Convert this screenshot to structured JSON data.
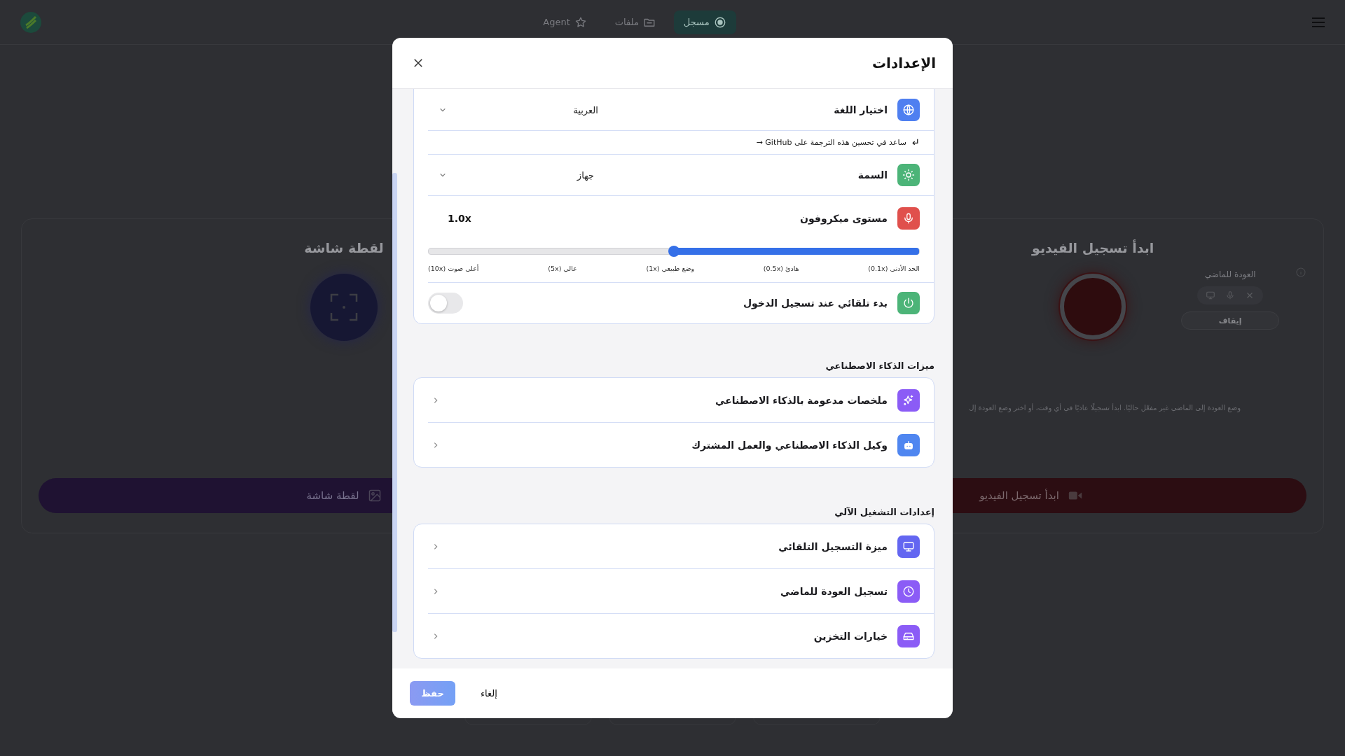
{
  "nav": {
    "tabs": [
      {
        "label": "مسجل",
        "selected": true
      },
      {
        "label": "ملفات",
        "selected": false
      },
      {
        "label": "Agent",
        "selected": false
      }
    ]
  },
  "screenshot_card": {
    "title": "لقطة شاشة",
    "button": "لقطة شاشة"
  },
  "video_card": {
    "title": "ابدأ تسجيل الفيديو",
    "rewind_title": "العودة للماضي",
    "stop_button": "إيقاف",
    "description": "وضع العودة إلى الماضي غير مفعّل حاليًا. ابدأ تسجيلًا عاديًا في أي وقت، أو اختر وضع العودة إل",
    "button": "ابدأ تسجيل الفيديو"
  },
  "settings": {
    "title": "الإعدادات",
    "general": [
      {
        "kind": "select",
        "label": "اختيار اللغة",
        "value": "العربية",
        "color": "#4f7ff0"
      },
      {
        "kind": "link",
        "label": "ساعد في تحسين هذه الترجمة على GitHub →"
      },
      {
        "kind": "select",
        "label": "السمة",
        "value": "جهاز",
        "color": "#4cb478"
      },
      {
        "kind": "slider",
        "label": "مستوى ميكروفون",
        "reading": "1.0x",
        "level": 0.5,
        "color": "#e0504c",
        "ticks": [
          "الحد الأدنى (0.1x)",
          "هادئ (0.5x)",
          "وضع طبيعي (1x)",
          "عالي (5x)",
          "أعلى صوت (10x)"
        ]
      },
      {
        "kind": "toggle",
        "label": "بدء تلقائي عند تسجيل الدخول",
        "on": false,
        "color": "#4cb478"
      }
    ],
    "ai_heading": "ميزات الذكاء الاصطناعي",
    "ai": [
      {
        "label": "ملخصات مدعومة بالذكاء الاصطناعي",
        "color": "#8b5cf6"
      },
      {
        "label": "وكيل الذكاء الاصطناعي والعمل المشترك",
        "color": "#4f86f0"
      }
    ],
    "auto_heading": "إعدادات التشغيل الآلي",
    "auto": [
      {
        "label": "ميزة التسجيل التلقائي",
        "color": "#6366f1"
      },
      {
        "label": "تسجيل العودة للماضي",
        "color": "#8b5cf6"
      },
      {
        "label": "خيارات التخزين",
        "color": "#8b5cf6"
      }
    ],
    "save": "حفظ",
    "cancel": "إلغاء"
  }
}
